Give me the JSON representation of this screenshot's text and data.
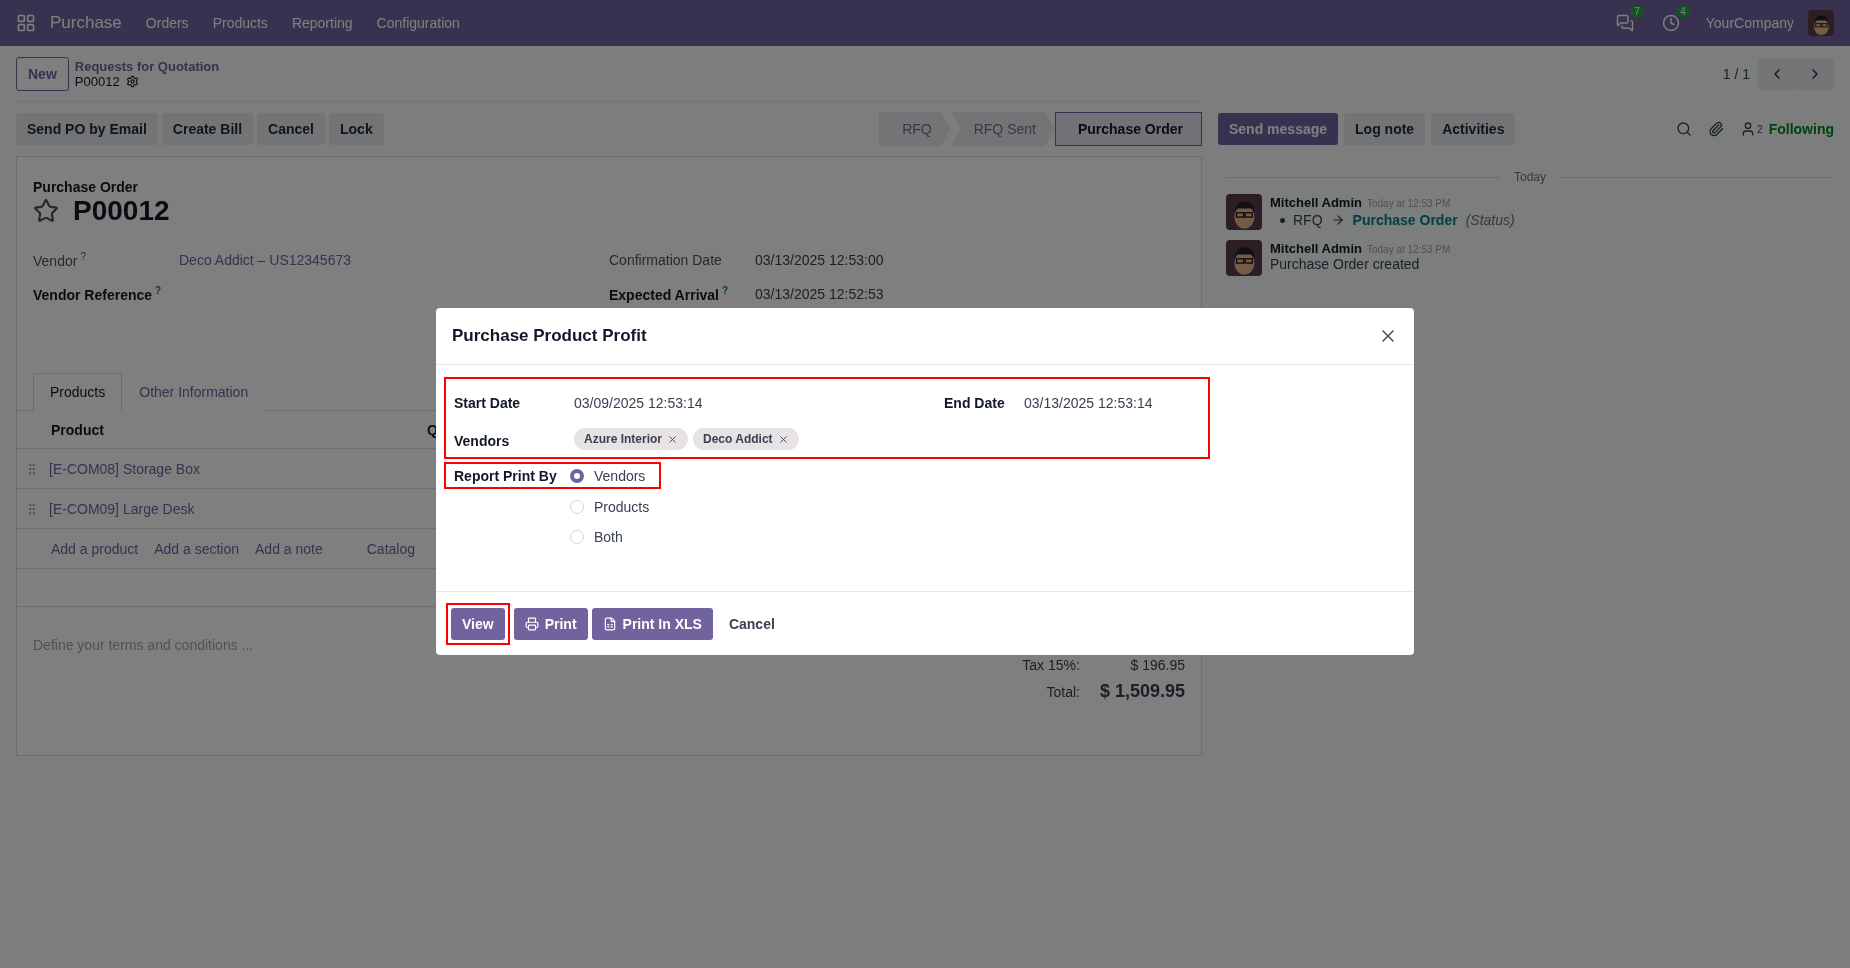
{
  "navbar": {
    "app": "Purchase",
    "menu": [
      "Orders",
      "Products",
      "Reporting",
      "Configuration"
    ],
    "messages_count": "7",
    "activities_count": "4",
    "company": "YourCompany"
  },
  "control_panel": {
    "new_button": "New",
    "breadcrumb": "Requests for Quotation",
    "record": "P00012",
    "pager": "1 / 1"
  },
  "actions": [
    "Send PO by Email",
    "Create Bill",
    "Cancel",
    "Lock"
  ],
  "statusbar": [
    {
      "label": "RFQ",
      "selected": false
    },
    {
      "label": "RFQ Sent",
      "selected": false
    },
    {
      "label": "Purchase Order",
      "selected": true
    }
  ],
  "chatter": {
    "buttons": [
      {
        "label": "Send message",
        "kind": "primary"
      },
      {
        "label": "Log note",
        "kind": "secondary"
      },
      {
        "label": "Activities",
        "kind": "secondary"
      }
    ],
    "followers_count": "2",
    "following": "Following",
    "separator": "Today",
    "messages": [
      {
        "kind": "tracking",
        "author": "Mitchell Admin",
        "time": "Today at 12:53 PM",
        "from": "RFQ",
        "to": "Purchase Order",
        "field": "(Status)"
      },
      {
        "kind": "text",
        "author": "Mitchell Admin",
        "time": "Today at 12:53 PM",
        "body": "Purchase Order created"
      }
    ]
  },
  "form": {
    "title_label": "Purchase Order",
    "name": "P00012",
    "starred": false,
    "left_fields": [
      {
        "label": "Vendor",
        "help": "?",
        "value": "Deco Addict – US12345673",
        "strong": false
      },
      {
        "label": "Vendor Reference",
        "help": "?",
        "strong": true
      }
    ],
    "right_fields": [
      {
        "label": "Confirmation Date",
        "value": "03/13/2025 12:53:00",
        "strong": false
      },
      {
        "label": "Expected Arrival",
        "help": "?",
        "value": "03/13/2025 12:52:53",
        "strong": true
      }
    ],
    "tabs": [
      {
        "label": "Products",
        "selected": true
      },
      {
        "label": "Other Information",
        "selected": false
      }
    ],
    "columns": [
      "Product",
      "Q"
    ],
    "rows": [
      "[E-COM08] Storage Box",
      "[E-COM09] Large Desk"
    ],
    "add_links": [
      "Add a product",
      "Add a section",
      "Add a note",
      "Catalog"
    ],
    "terms_placeholder": "Define your terms and conditions ...",
    "totals": [
      {
        "label": "Tax 15%:",
        "value": "$ 196.95",
        "kind": "line"
      },
      {
        "label": "Total:",
        "value": "$ 1,509.95",
        "kind": "grand"
      }
    ]
  },
  "dialog": {
    "title": "Purchase Product Profit",
    "start_label": "Start Date",
    "start_value": "03/09/2025 12:53:14",
    "end_label": "End Date",
    "end_value": "03/13/2025 12:53:14",
    "vendors_label": "Vendors",
    "vendors": [
      "Azure Interior",
      "Deco Addict"
    ],
    "report_label": "Report Print By",
    "options": [
      {
        "label": "Vendors",
        "selected": true
      },
      {
        "label": "Products",
        "selected": false
      },
      {
        "label": "Both",
        "selected": false
      }
    ],
    "buttons": [
      {
        "label": "View",
        "kind": "view"
      },
      {
        "label": "Print",
        "kind": "print"
      },
      {
        "label": "Print In XLS",
        "kind": "xls"
      },
      {
        "label": "Cancel",
        "kind": "cancel"
      }
    ]
  }
}
